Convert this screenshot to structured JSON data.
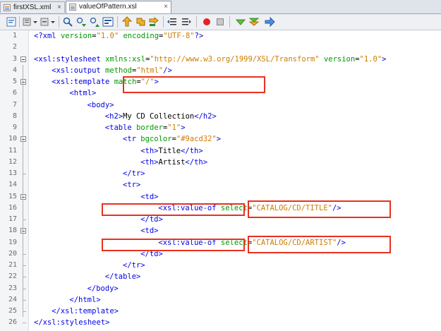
{
  "tabs": [
    {
      "label": "firstXSL.xml",
      "close": "×"
    },
    {
      "label": "valueOfPattern.xsl",
      "close": "×"
    }
  ],
  "toolbar": {
    "icons": [
      "source-view-icon",
      "history-icon",
      "dropdown-icon",
      "back-icon",
      "dropdown-icon",
      "find-icon",
      "find-prev-icon",
      "find-next-icon",
      "toggle-highlight-icon",
      "prev-bookmark-icon",
      "next-bookmark-icon",
      "toggle-bookmark-icon",
      "shift-left-icon",
      "shift-right-icon",
      "record-macro-icon",
      "stop-macro-icon",
      "validate-icon",
      "check-xml-icon",
      "xslt-run-icon"
    ]
  },
  "lines": [
    {
      "n": "1",
      "parts": [
        [
          "tag",
          "<?xml "
        ],
        [
          "attr",
          "version"
        ],
        [
          "txt",
          "="
        ],
        [
          "val",
          "\"1.0\""
        ],
        [
          "txt",
          " "
        ],
        [
          "attr",
          "encoding"
        ],
        [
          "txt",
          "="
        ],
        [
          "val",
          "\"UTF-8\""
        ],
        [
          "tag",
          "?>"
        ]
      ]
    },
    {
      "n": "2",
      "parts": []
    },
    {
      "n": "3",
      "parts": [
        [
          "tag",
          "<xsl:stylesheet "
        ],
        [
          "attr",
          "xmlns:xsl"
        ],
        [
          "txt",
          "="
        ],
        [
          "val",
          "\"http://www.w3.org/1999/XSL/Transform\""
        ],
        [
          "txt",
          " "
        ],
        [
          "attr",
          "version"
        ],
        [
          "txt",
          "="
        ],
        [
          "val",
          "\"1.0\""
        ],
        [
          "tag",
          ">"
        ]
      ]
    },
    {
      "n": "4",
      "parts": [
        [
          "tag",
          "<xsl:output "
        ],
        [
          "attr",
          "method"
        ],
        [
          "txt",
          "="
        ],
        [
          "val",
          "\"html\""
        ],
        [
          "tag",
          "/>"
        ]
      ]
    },
    {
      "n": "5",
      "parts": [
        [
          "tag",
          "<xsl:template "
        ],
        [
          "attr",
          "match"
        ],
        [
          "txt",
          "="
        ],
        [
          "val",
          "\"/\""
        ],
        [
          "tag",
          ">"
        ]
      ]
    },
    {
      "n": "6",
      "parts": [
        [
          "tag",
          "<html>"
        ]
      ]
    },
    {
      "n": "7",
      "parts": [
        [
          "tag",
          "<body>"
        ]
      ]
    },
    {
      "n": "8",
      "parts": [
        [
          "tag",
          "<h2>"
        ],
        [
          "txt",
          "My CD Collection"
        ],
        [
          "tag",
          "</h2>"
        ]
      ]
    },
    {
      "n": "9",
      "parts": [
        [
          "tag",
          "<table "
        ],
        [
          "attr",
          "border"
        ],
        [
          "txt",
          "="
        ],
        [
          "val",
          "\"1\""
        ],
        [
          "tag",
          ">"
        ]
      ]
    },
    {
      "n": "10",
      "parts": [
        [
          "tag",
          "<tr "
        ],
        [
          "attr",
          "bgcolor"
        ],
        [
          "txt",
          "="
        ],
        [
          "val",
          "\"#9acd32\""
        ],
        [
          "tag",
          ">"
        ]
      ]
    },
    {
      "n": "11",
      "parts": [
        [
          "tag",
          "<th>"
        ],
        [
          "txt",
          "Title"
        ],
        [
          "tag",
          "</th>"
        ]
      ]
    },
    {
      "n": "12",
      "parts": [
        [
          "tag",
          "<th>"
        ],
        [
          "txt",
          "Artist"
        ],
        [
          "tag",
          "</th>"
        ]
      ]
    },
    {
      "n": "13",
      "parts": [
        [
          "tag",
          "</tr>"
        ]
      ]
    },
    {
      "n": "14",
      "parts": [
        [
          "tag",
          "<tr>"
        ]
      ]
    },
    {
      "n": "15",
      "parts": [
        [
          "tag",
          "<td>"
        ]
      ]
    },
    {
      "n": "16",
      "parts": [
        [
          "tag",
          "<xsl:value-of "
        ],
        [
          "attr",
          "select"
        ],
        [
          "txt",
          "="
        ],
        [
          "val",
          "\"CATALOG/CD/TITLE\""
        ],
        [
          "tag",
          "/>"
        ]
      ]
    },
    {
      "n": "17",
      "parts": [
        [
          "tag",
          "</td>"
        ]
      ]
    },
    {
      "n": "18",
      "parts": [
        [
          "tag",
          "<td>"
        ]
      ]
    },
    {
      "n": "19",
      "parts": [
        [
          "tag",
          "<xsl:value-of "
        ],
        [
          "attr",
          "select"
        ],
        [
          "txt",
          "="
        ],
        [
          "val",
          "\"CATALOG/CD/ARTIST\""
        ],
        [
          "tag",
          "/>"
        ]
      ]
    },
    {
      "n": "20",
      "parts": [
        [
          "tag",
          "</td>"
        ]
      ]
    },
    {
      "n": "21",
      "parts": [
        [
          "tag",
          "</tr>"
        ]
      ]
    },
    {
      "n": "22",
      "parts": [
        [
          "tag",
          "</table>"
        ]
      ]
    },
    {
      "n": "23",
      "parts": [
        [
          "tag",
          "</body>"
        ]
      ]
    },
    {
      "n": "24",
      "parts": [
        [
          "tag",
          "</html>"
        ]
      ]
    },
    {
      "n": "25",
      "parts": [
        [
          "tag",
          "</xsl:template>"
        ]
      ]
    },
    {
      "n": "26",
      "parts": [
        [
          "tag",
          "</xsl:stylesheet>"
        ]
      ]
    }
  ],
  "colors": {
    "tag": "#0000e6",
    "attr": "#009900",
    "value": "#ce7b00",
    "highlight": "#e8311f"
  }
}
